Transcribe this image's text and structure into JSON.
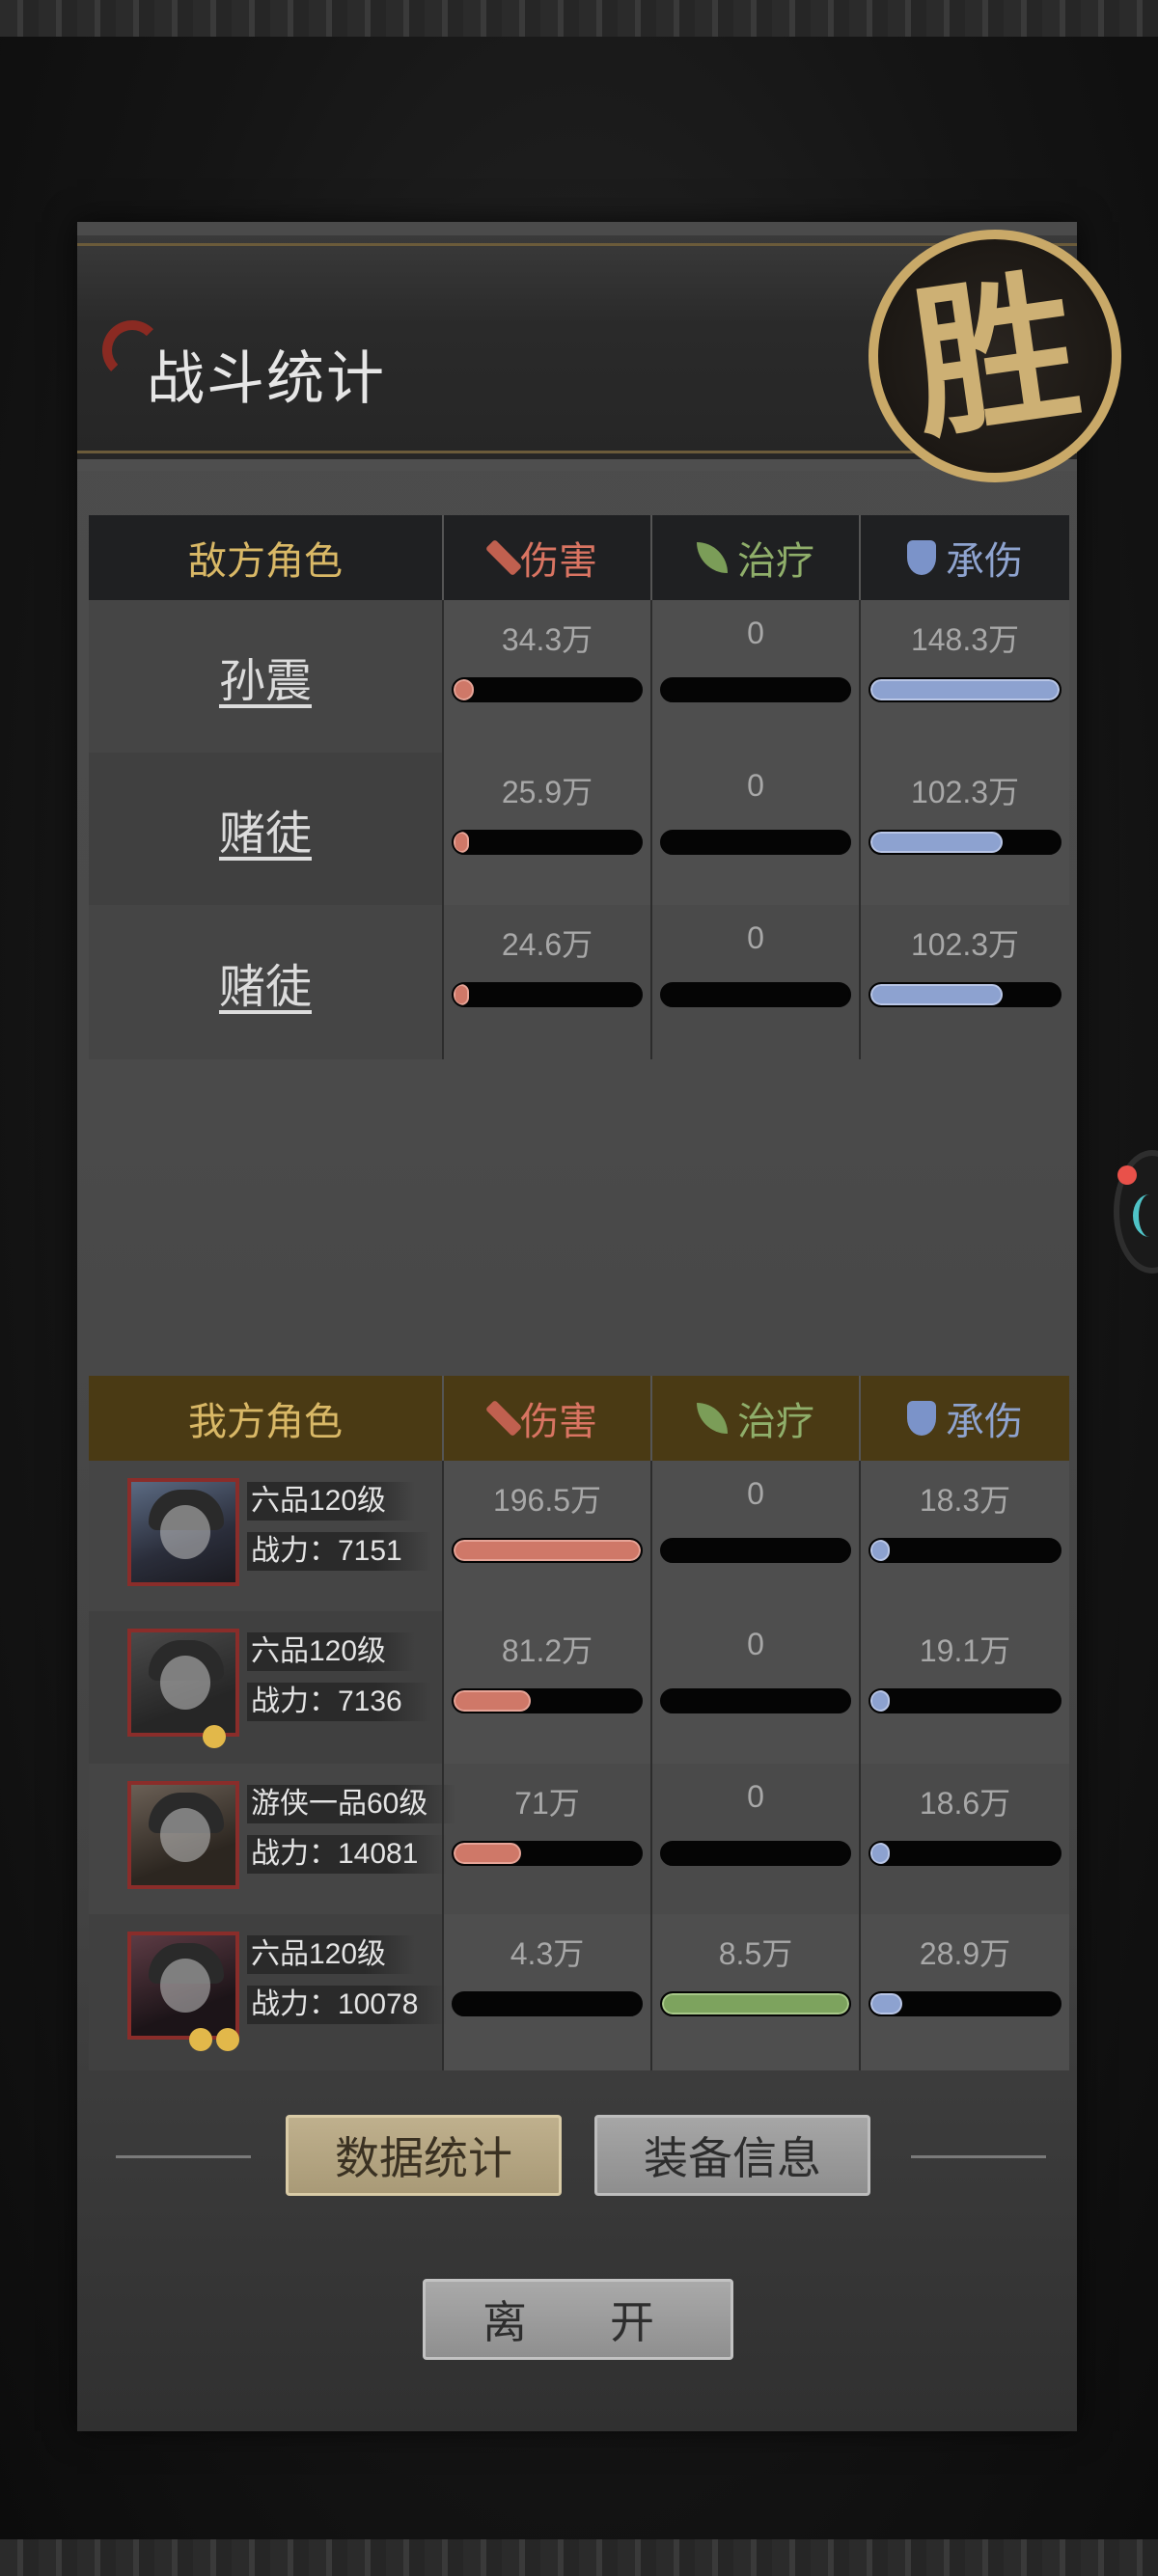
{
  "header": {
    "title": "战斗统计",
    "victory_mark": "胜"
  },
  "columns": {
    "damage": "伤害",
    "healing": "治疗",
    "tanking": "承伤"
  },
  "enemy": {
    "header": "敌方角色",
    "rows": [
      {
        "name": "孙震",
        "damage": "34.3万",
        "healing": "0",
        "tanking": "148.3万",
        "damage_frac": 0.11,
        "healing_frac": 0,
        "tanking_frac": 1.0
      },
      {
        "name": "赌徒",
        "damage": "25.9万",
        "healing": "0",
        "tanking": "102.3万",
        "damage_frac": 0.08,
        "healing_frac": 0,
        "tanking_frac": 0.7
      },
      {
        "name": "赌徒",
        "damage": "24.6万",
        "healing": "0",
        "tanking": "102.3万",
        "damage_frac": 0.07,
        "healing_frac": 0,
        "tanking_frac": 0.7
      }
    ]
  },
  "ally": {
    "header": "我方角色",
    "rows": [
      {
        "rank": "六品120级",
        "power": "战力：7151",
        "damage": "196.5万",
        "healing": "0",
        "tanking": "18.3万",
        "damage_frac": 1.0,
        "healing_frac": 0,
        "tanking_frac": 0.1
      },
      {
        "rank": "六品120级",
        "power": "战力：7136",
        "damage": "81.2万",
        "healing": "0",
        "tanking": "19.1万",
        "damage_frac": 0.41,
        "healing_frac": 0,
        "tanking_frac": 0.1
      },
      {
        "rank": "游侠一品60级",
        "power": "战力：14081",
        "damage": "71万",
        "healing": "0",
        "tanking": "18.6万",
        "damage_frac": 0.36,
        "healing_frac": 0,
        "tanking_frac": 0.1
      },
      {
        "rank": "六品120级",
        "power": "战力：10078",
        "damage": "4.3万",
        "healing": "8.5万",
        "tanking": "28.9万",
        "damage_frac": 0.0,
        "healing_frac": 1.0,
        "tanking_frac": 0.17
      }
    ]
  },
  "buttons": {
    "stats": "数据统计",
    "equipment": "装备信息",
    "leave": "离　开"
  },
  "colors": {
    "damage": "#cf7868",
    "healing": "#7da35e",
    "tanking": "#8da2d0",
    "enemy_header_bg": "#1f2022",
    "ally_header_bg": "#4a3a14"
  }
}
